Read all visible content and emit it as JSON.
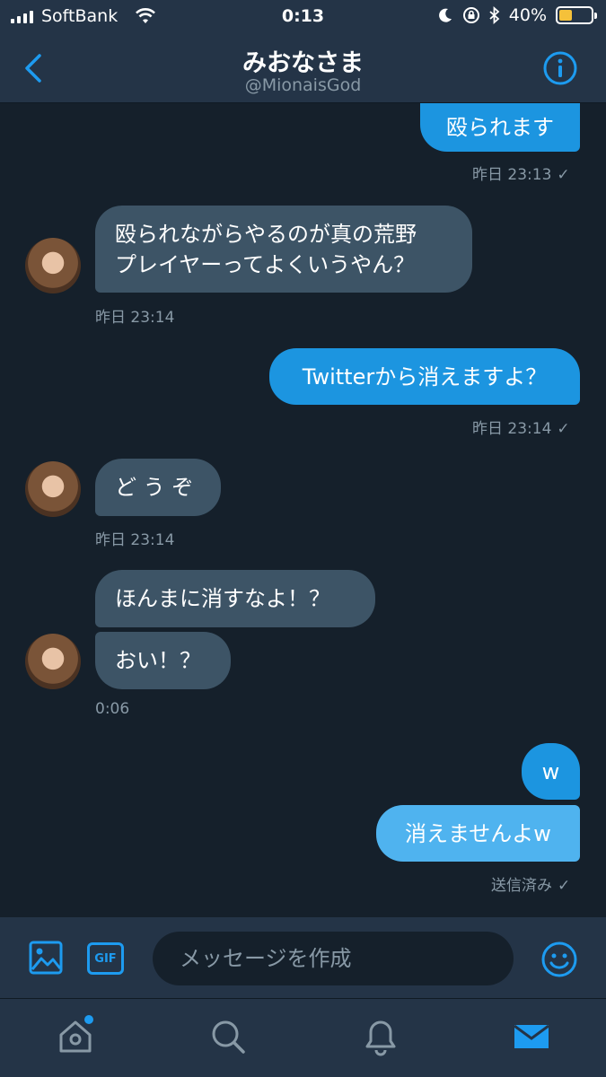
{
  "status_bar": {
    "carrier": "SoftBank",
    "time": "0:13",
    "battery_percent": "40%",
    "battery_level": 0.4,
    "battery_color": "#f5c13a"
  },
  "header": {
    "title": "みおなさま",
    "handle": "@MionaisGod",
    "back_icon": "chevron-left-icon",
    "info_icon": "info-icon"
  },
  "messages": [
    {
      "from": "me",
      "text": "殴られます"
    },
    {
      "meta": "昨日 23:13",
      "read_mark": "✓"
    },
    {
      "from": "them",
      "lines": [
        "殴られながらやるのが真の荒野",
        "プレイヤーってよくいうやん？"
      ]
    },
    {
      "meta": "昨日 23:14"
    },
    {
      "from": "me",
      "text": "Twitterから消えますよ？"
    },
    {
      "meta": "昨日 23:14",
      "read_mark": "✓"
    },
    {
      "from": "them",
      "text": "ど う ぞ"
    },
    {
      "meta": "昨日 23:14"
    },
    {
      "from": "them",
      "text": "ほんまに消すなよ！？"
    },
    {
      "from": "them",
      "text": "おい！？"
    },
    {
      "meta": "0:06"
    },
    {
      "from": "me",
      "text": "w"
    },
    {
      "from": "me",
      "text": "消えませんよw"
    },
    {
      "meta": "送信済み",
      "read_mark": "✓"
    }
  ],
  "composer": {
    "placeholder": "メッセージを作成",
    "gif_label": "GIF"
  },
  "colors": {
    "background": "#15202b",
    "bar": "#243447",
    "accent": "#1d9bf0",
    "outgoing_bubble": "#1c95e0",
    "incoming_bubble": "#3d5466"
  },
  "tabs": [
    "home-icon",
    "search-icon",
    "bell-icon",
    "mail-icon"
  ]
}
